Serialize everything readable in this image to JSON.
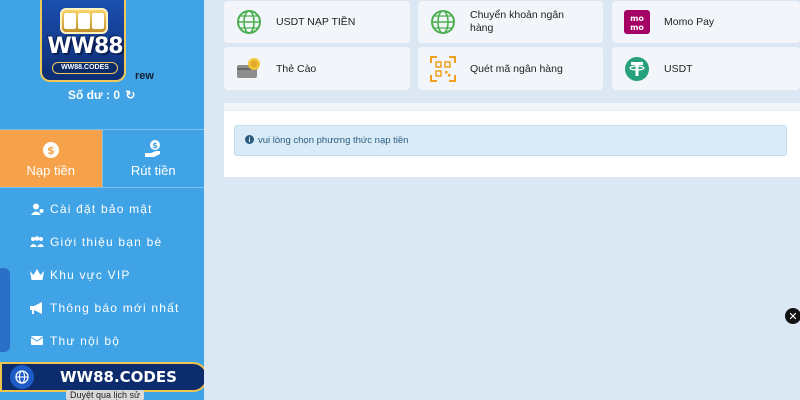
{
  "sidebar": {
    "logo_text": "WW88",
    "logo_sub": "WW88.CODES",
    "username_partial": "rew",
    "balance_label": "Số dư : 0",
    "actions": {
      "deposit": "Nạp tiền",
      "withdraw": "Rút tiền"
    },
    "menu": [
      {
        "label": "Cài đặt bảo mật",
        "icon": "user-shield-icon"
      },
      {
        "label": "Giới thiệu bạn bè",
        "icon": "users-icon"
      },
      {
        "label": "Khu vực VIP",
        "icon": "crown-icon"
      },
      {
        "label": "Thông báo mới nhất",
        "icon": "megaphone-icon"
      },
      {
        "label": "Thư nội bộ",
        "icon": "envelope-icon"
      }
    ],
    "banner_text": "WW88.CODES",
    "history_hint": "Duyệt qua lịch sử"
  },
  "methods": [
    {
      "label": "USDT NẠP TIỀN",
      "icon": "globe-icon"
    },
    {
      "label": "Chuyển khoản ngân hàng",
      "icon": "globe-icon"
    },
    {
      "label": "Momo Pay",
      "icon": "momo-icon"
    },
    {
      "label": "Thẻ Cào",
      "icon": "card-icon"
    },
    {
      "label": "Quét mã ngân hàng",
      "icon": "qr-icon"
    },
    {
      "label": "USDT",
      "icon": "tether-icon"
    }
  ],
  "notice": "vui lòng chọn phương thức nạp tiền",
  "colors": {
    "sidebar_bg": "#3fa3e6",
    "deposit_active": "#f6a24b",
    "main_bg": "#dbe7f3",
    "momo": "#a50064",
    "tether": "#26a17b",
    "banner_bg": "#0c2c6e",
    "banner_border": "#f2c24e"
  }
}
